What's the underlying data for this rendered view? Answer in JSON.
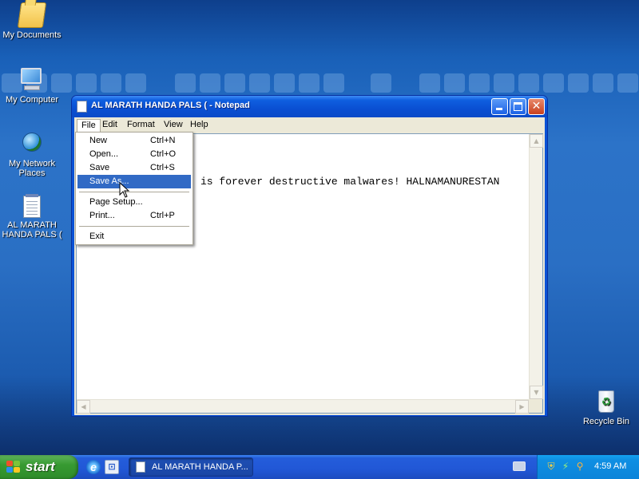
{
  "desktop": {
    "icons": [
      {
        "label": "My Documents",
        "icon": "folder-icon"
      },
      {
        "label": "My Computer",
        "icon": "computer-icon"
      },
      {
        "label": "My Network Places",
        "icon": "network-icon"
      },
      {
        "label": "AL MARATH HANDA PALS (",
        "icon": "notepad-file-icon"
      },
      {
        "label": "Recycle Bin",
        "icon": "recycle-bin-icon"
      }
    ]
  },
  "window": {
    "title": "AL MARATH HANDA PALS ( - Notepad",
    "menu": [
      "File",
      "Edit",
      "Format",
      "View",
      "Help"
    ],
    "open_menu": "File",
    "content": "is forever destructive malwares! HALNAMANURESTAN"
  },
  "file_menu": {
    "items": [
      {
        "label": "New",
        "shortcut": "Ctrl+N"
      },
      {
        "label": "Open...",
        "shortcut": "Ctrl+O"
      },
      {
        "label": "Save",
        "shortcut": "Ctrl+S"
      },
      {
        "label": "Save As...",
        "shortcut": "",
        "highlighted": true
      },
      {
        "label": "Page Setup...",
        "shortcut": ""
      },
      {
        "label": "Print...",
        "shortcut": "Ctrl+P"
      },
      {
        "label": "Exit",
        "shortcut": ""
      }
    ]
  },
  "taskbar": {
    "start_label": "start",
    "task_label": "AL MARATH HANDA P...",
    "clock": "4:59 AM"
  },
  "colors": {
    "highlight": "#316ac5",
    "titlebar": "#0a4fd2",
    "start": "#379a32",
    "tray": "#0f8fe3"
  }
}
